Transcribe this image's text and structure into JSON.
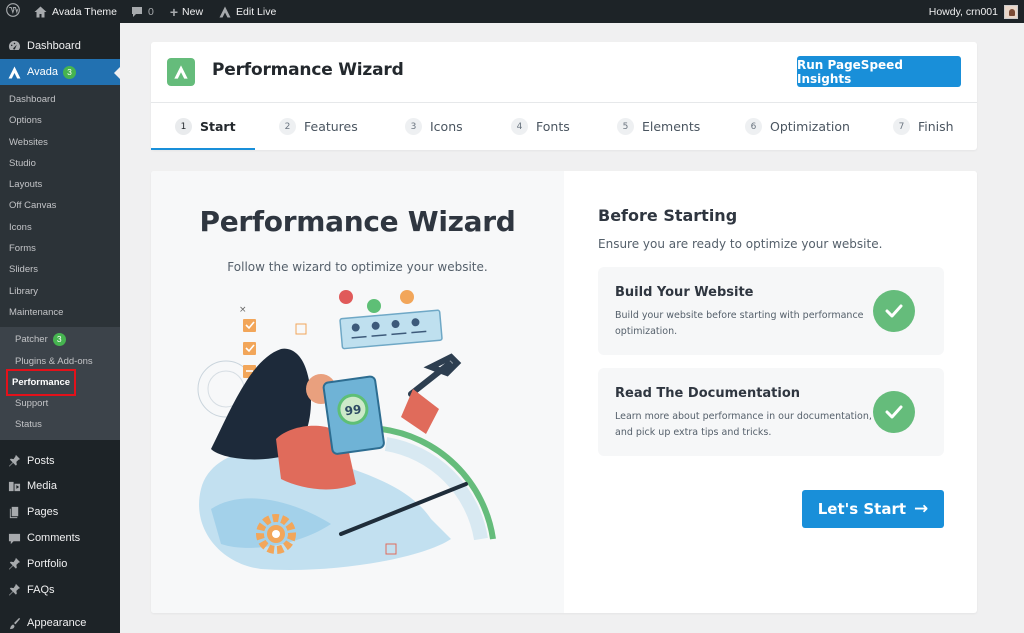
{
  "adminbar": {
    "site_name": "Avada Theme",
    "comments_count": "0",
    "new_label": "New",
    "edit_live_label": "Edit Live",
    "greeting": "Howdy, crn001"
  },
  "sidebar": {
    "dashboard": "Dashboard",
    "avada": {
      "label": "Avada",
      "badge": "3"
    },
    "avada_submenu": [
      "Dashboard",
      "Options",
      "Websites",
      "Studio",
      "Layouts",
      "Off Canvas",
      "Icons",
      "Forms",
      "Sliders",
      "Library",
      "Maintenance"
    ],
    "maintenance_submenu": [
      {
        "label": "Patcher",
        "badge": "3"
      },
      {
        "label": "Plugins & Add-ons"
      },
      {
        "label": "Performance",
        "active": true
      },
      {
        "label": "Support"
      },
      {
        "label": "Status"
      }
    ],
    "lower_items": [
      {
        "label": "Posts",
        "icon": "pin-icon"
      },
      {
        "label": "Media",
        "icon": "media-icon"
      },
      {
        "label": "Pages",
        "icon": "pages-icon"
      },
      {
        "label": "Comments",
        "icon": "comment-icon"
      },
      {
        "label": "Portfolio",
        "icon": "pin-icon"
      },
      {
        "label": "FAQs",
        "icon": "pin-icon"
      },
      {
        "label": "Appearance",
        "icon": "brush-icon"
      }
    ]
  },
  "header": {
    "title": "Performance Wizard",
    "pagespeed_button": "Run PageSpeed Insights",
    "steps": [
      {
        "num": "1",
        "label": "Start",
        "active": true
      },
      {
        "num": "2",
        "label": "Features"
      },
      {
        "num": "3",
        "label": "Icons"
      },
      {
        "num": "4",
        "label": "Fonts"
      },
      {
        "num": "5",
        "label": "Elements"
      },
      {
        "num": "6",
        "label": "Optimization"
      },
      {
        "num": "7",
        "label": "Finish"
      }
    ]
  },
  "main": {
    "left_title": "Performance Wizard",
    "left_subtitle": "Follow the wizard to optimize your website.",
    "gauge_value": "99",
    "right_title": "Before Starting",
    "right_subtitle": "Ensure you are ready to optimize your website.",
    "checks": [
      {
        "title": "Build Your Website",
        "description": "Build your website before starting with performance optimization.",
        "checked": true
      },
      {
        "title": "Read The Documentation",
        "description": "Learn more about performance in our documentation, and pick up extra tips and tricks.",
        "checked": true
      }
    ],
    "start_button": "Let's Start",
    "start_arrow": "→"
  },
  "colors": {
    "accent_blue": "#198fd9",
    "check_green": "#65bc7b",
    "wp_dark": "#1d2327",
    "wp_current": "#2271b1",
    "highlight_red": "#e3111a"
  }
}
